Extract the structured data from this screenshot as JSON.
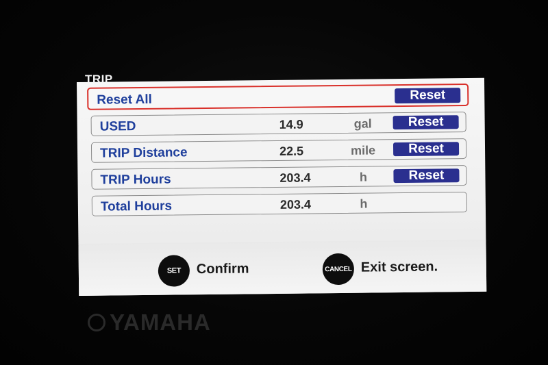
{
  "screen": {
    "title": "TRIP"
  },
  "rows": [
    {
      "label": "Reset All",
      "value": "",
      "unit": "",
      "button": "Reset",
      "selected": true
    },
    {
      "label": "USED",
      "value": "14.9",
      "unit": "gal",
      "button": "Reset"
    },
    {
      "label": "TRIP Distance",
      "value": "22.5",
      "unit": "mile",
      "button": "Reset"
    },
    {
      "label": "TRIP Hours",
      "value": "203.4",
      "unit": "h",
      "button": "Reset"
    },
    {
      "label": "Total Hours",
      "value": "203.4",
      "unit": "h",
      "button": ""
    }
  ],
  "footer": {
    "set_button": "SET",
    "confirm_label": "Confirm",
    "cancel_button": "CANCEL",
    "exit_label": "Exit screen."
  },
  "brand": {
    "name": "YAMAHA"
  }
}
